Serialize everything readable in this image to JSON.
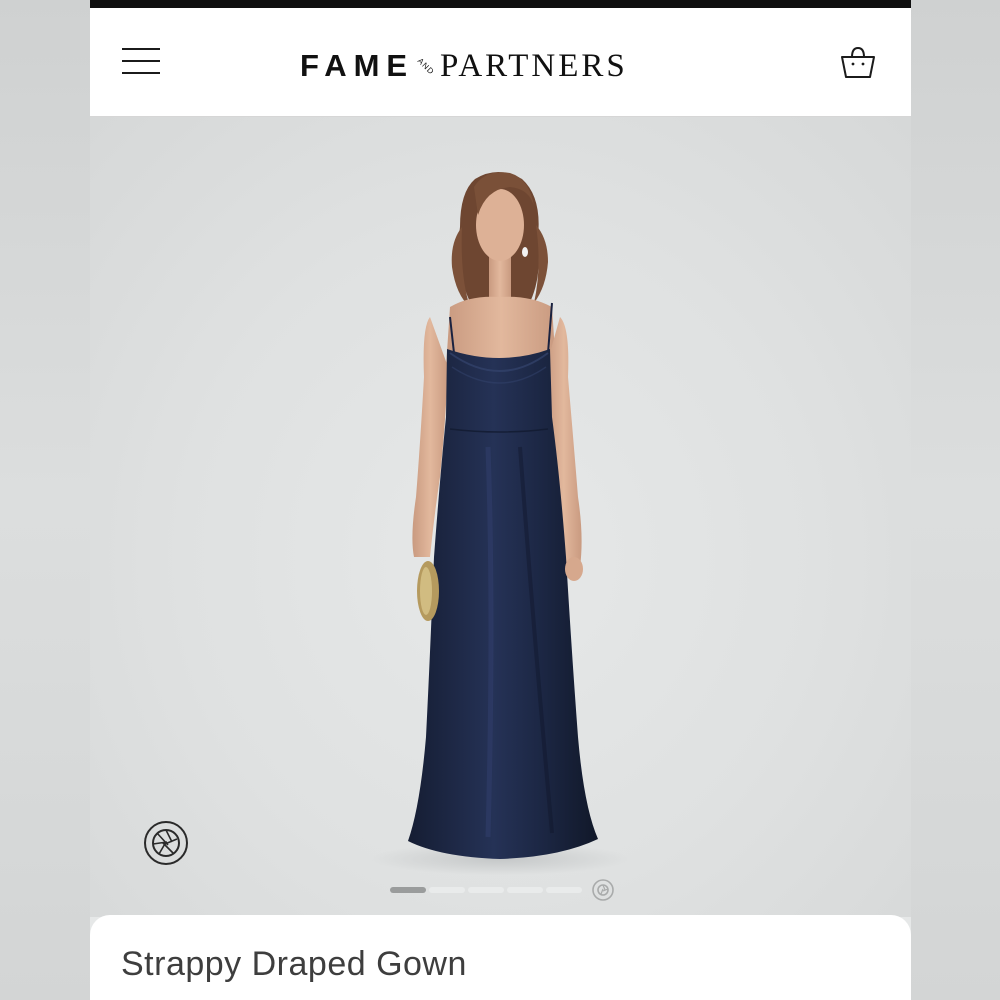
{
  "header": {
    "brand_primary": "FAME",
    "brand_connector": "AND",
    "brand_secondary": "PARTNERS",
    "menu_icon": "hamburger-menu-icon",
    "bag_icon": "shopping-bag-icon"
  },
  "gallery": {
    "image_count": 5,
    "active_index": 0,
    "view_360_icon": "camera-aperture-360-icon",
    "pager_end_icon": "360-view-icon"
  },
  "product": {
    "title": "Strappy Draped Gown"
  },
  "colors": {
    "header_bg": "#ffffff",
    "brand_text": "#111111",
    "dress": "#1f2a48",
    "photo_backdrop": "#e2e4e4",
    "title_text": "#3e3e3e"
  }
}
